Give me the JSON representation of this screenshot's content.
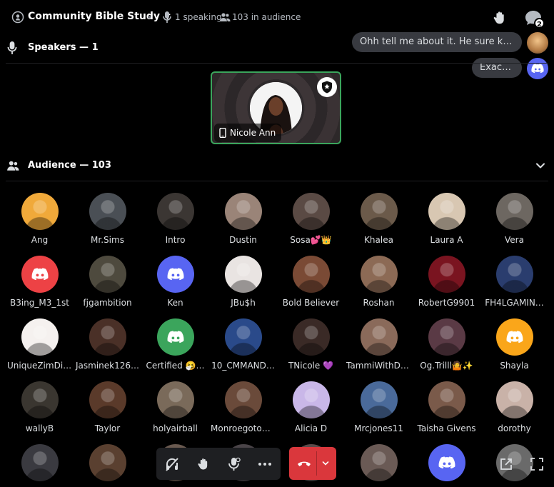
{
  "header": {
    "title": "Community Bible Study ✝",
    "speaking": "1 speaking",
    "audience": "103 in audience",
    "chat_badge": "2"
  },
  "toasts": [
    {
      "text": "Ohh tell me about it. He sure kno…"
    },
    {
      "text": "Exactly!"
    }
  ],
  "speakers": {
    "heading": "Speakers — 1",
    "list": [
      {
        "name": "Nicole Ann"
      }
    ]
  },
  "audience": {
    "heading": "Audience — 103",
    "members": [
      {
        "name": "Ang",
        "bg": "#f0a93a"
      },
      {
        "name": "Mr.Sims",
        "bg": "#4a4f55"
      },
      {
        "name": "Intro",
        "bg": "#3b3633"
      },
      {
        "name": "Dustin",
        "bg": "#9a8478"
      },
      {
        "name": "Sosa💕👑",
        "bg": "#5a4a44"
      },
      {
        "name": "Khalea",
        "bg": "#6b5a4a"
      },
      {
        "name": "Laura A",
        "bg": "#d8c7b2"
      },
      {
        "name": "Vera",
        "bg": "#6d6761"
      },
      {
        "name": "B3ing_M3_1st",
        "bg": "#ed4245",
        "discord": true
      },
      {
        "name": "fjgambition",
        "bg": "#4e4a3e"
      },
      {
        "name": "Ken",
        "bg": "#5865f2",
        "discord": true
      },
      {
        "name": "JBu$h",
        "bg": "#e9e4e2"
      },
      {
        "name": "Bold Believer",
        "bg": "#7a4a35"
      },
      {
        "name": "Roshan",
        "bg": "#8c6a55"
      },
      {
        "name": "RobertG9901",
        "bg": "#7a1420"
      },
      {
        "name": "FH4LGAMIN…",
        "bg": "#2a3d6e"
      },
      {
        "name": "UniqueZimDiva",
        "bg": "#f5f1ef"
      },
      {
        "name": "Jasminek126…",
        "bg": "#4a3027"
      },
      {
        "name": "Certified 🤧…",
        "bg": "#3ba55c",
        "discord": true
      },
      {
        "name": "10_CMMAND…",
        "bg": "#2a4a8a"
      },
      {
        "name": "TNicole 💜",
        "bg": "#3a2a26"
      },
      {
        "name": "TammiWithDa…",
        "bg": "#8a6a5a"
      },
      {
        "name": "Og.Trilll🤷✨",
        "bg": "#5a3a45"
      },
      {
        "name": "Shayla",
        "bg": "#faa61a",
        "discord": true
      },
      {
        "name": "wallyB",
        "bg": "#3a3630"
      },
      {
        "name": "Taylor",
        "bg": "#5a3a2a"
      },
      {
        "name": "holyairball",
        "bg": "#7a6a5a"
      },
      {
        "name": "Monroegotop…",
        "bg": "#6a4a3a"
      },
      {
        "name": "Alicia D",
        "bg": "#c9b7e8"
      },
      {
        "name": "Mrcjones11",
        "bg": "#4a6a9a"
      },
      {
        "name": "Taisha Givens",
        "bg": "#7a5a4a"
      },
      {
        "name": "dorothy",
        "bg": "#c9b2a8"
      },
      {
        "name": "",
        "bg": "#3a3a40"
      },
      {
        "name": "",
        "bg": "#5a4030"
      },
      {
        "name": "",
        "bg": "#6a5a50"
      },
      {
        "name": "",
        "bg": "#4a4448"
      },
      {
        "name": "",
        "bg": "#5a4a4a"
      },
      {
        "name": "",
        "bg": "#6a5a55"
      },
      {
        "name": "",
        "bg": "#5865f2",
        "discord": true
      },
      {
        "name": "",
        "bg": "#6a6a6a"
      }
    ]
  },
  "colors": {
    "discord_blurple": "#5865f2",
    "speaker_border": "#3ba55c",
    "leave_red": "#da373c",
    "toolbar_bg": "#1e1f22"
  }
}
